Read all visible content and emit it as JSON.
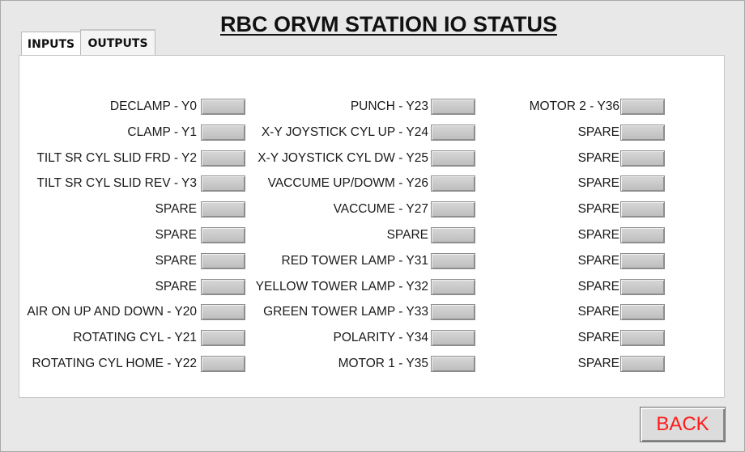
{
  "title": "RBC ORVM STATION IO STATUS",
  "tabs": [
    {
      "label": "INPUTS",
      "selected": false
    },
    {
      "label": "OUTPUTS",
      "selected": true
    }
  ],
  "outputs": {
    "column1": [
      "DECLAMP - Y0",
      "CLAMP - Y1",
      "TILT SR CYL SLID FRD - Y2",
      "TILT SR CYL SLID REV - Y3",
      "SPARE",
      "SPARE",
      "SPARE",
      "SPARE",
      "AIR ON UP AND DOWN - Y20",
      "ROTATING CYL - Y21",
      "ROTATING CYL HOME - Y22"
    ],
    "column2": [
      "PUNCH - Y23",
      "X-Y JOYSTICK CYL UP - Y24",
      "X-Y JOYSTICK CYL DW - Y25",
      "VACCUME UP/DOWM - Y26",
      "VACCUME - Y27",
      "SPARE",
      "RED TOWER LAMP - Y31",
      "YELLOW TOWER LAMP - Y32",
      "GREEN TOWER LAMP - Y33",
      "POLARITY - Y34",
      "MOTOR 1 - Y35"
    ],
    "column3": [
      "MOTOR 2 - Y36",
      "SPARE",
      "SPARE",
      "SPARE",
      "SPARE",
      "SPARE",
      "SPARE",
      "SPARE",
      "SPARE",
      "SPARE",
      "SPARE"
    ],
    "indicator_state": "off",
    "indicator_color": "#c8c8c8"
  },
  "back_button": {
    "label": "BACK",
    "color": "#ff1a1a"
  }
}
